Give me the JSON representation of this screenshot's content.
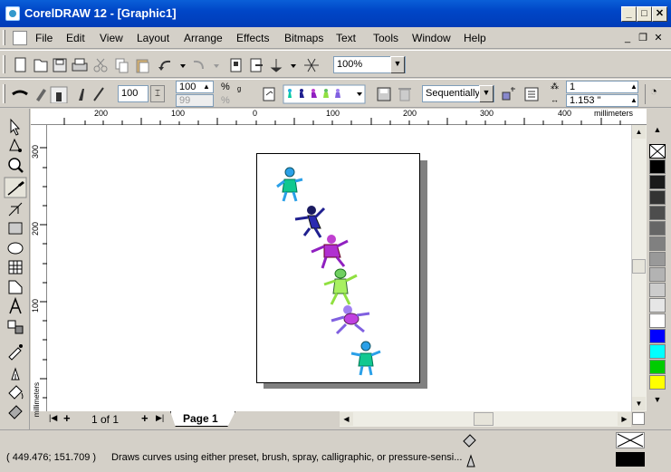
{
  "window": {
    "title": "CorelDRAW 12 - [Graphic1]",
    "minimize": "_",
    "maximize": "□",
    "close": "✕"
  },
  "menu": [
    "File",
    "Edit",
    "View",
    "Layout",
    "Arrange",
    "Effects",
    "Bitmaps",
    "Text",
    "Tools",
    "Window",
    "Help"
  ],
  "mdi": {
    "minimize": "_",
    "restore": "❐",
    "close": "✕"
  },
  "standard_toolbar": {
    "zoom_level": "100%"
  },
  "property_bar": {
    "brush_size": "100",
    "spray_size_top": "100",
    "spray_size_bottom": "99",
    "percent_top": "%",
    "percent_bottom": "%",
    "spray_order": "Sequentially",
    "dabs_per_spacing": "1",
    "spacing": "1.153 \""
  },
  "ruler": {
    "units": "millimeters",
    "h_labels": [
      "200",
      "100",
      "0",
      "100",
      "200",
      "300",
      "400"
    ],
    "v_labels": [
      "300",
      "200",
      "100"
    ]
  },
  "page_nav": {
    "counter": "1 of 1",
    "first": "|◀",
    "prev": "◀",
    "add_prev": "+",
    "add_next": "+",
    "next": "▶",
    "last": "▶|",
    "tab_label": "Page 1"
  },
  "palette": [
    "#000000",
    "#1a1a1a",
    "#333333",
    "#4d4d4d",
    "#666666",
    "#808080",
    "#999999",
    "#b3b3b3",
    "#cccccc",
    "#e6e6e6",
    "#ffffff",
    "#0000ff",
    "#00ffff",
    "#00cc00",
    "#ffff00"
  ],
  "status": {
    "coordinates": "( 449.476; 151.709 )",
    "message": "Draws curves using either preset, brush, spray, calligraphic, or pressure-sensi..."
  },
  "figures": [
    {
      "name": "figure-cyan-green",
      "body": "#00c8a0",
      "head": "#20b0e0"
    },
    {
      "name": "figure-dark-blue",
      "body": "#202090",
      "head": "#1a1a60"
    },
    {
      "name": "figure-purple",
      "body": "#9020c0",
      "head": "#c040d0"
    },
    {
      "name": "figure-yellow-green",
      "body": "#90e040",
      "head": "#60c060"
    },
    {
      "name": "figure-violet",
      "body": "#8060e0",
      "head": "#a080f0"
    },
    {
      "name": "figure-cyan-green-2",
      "body": "#00c8a0",
      "head": "#20b0e0"
    }
  ]
}
